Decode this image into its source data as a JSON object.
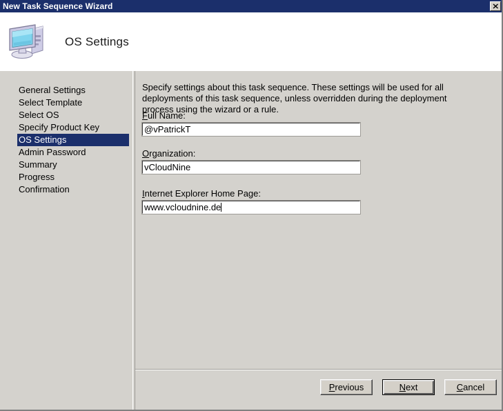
{
  "window": {
    "title": "New Task Sequence Wizard",
    "close_icon": "close-x-icon"
  },
  "header": {
    "title": "OS Settings",
    "icon": "computer-monitor-icon"
  },
  "navigation": {
    "items": [
      {
        "label": "General Settings",
        "selected": false
      },
      {
        "label": "Select Template",
        "selected": false
      },
      {
        "label": "Select OS",
        "selected": false
      },
      {
        "label": "Specify Product Key",
        "selected": false
      },
      {
        "label": "OS Settings",
        "selected": true
      },
      {
        "label": "Admin Password",
        "selected": false
      },
      {
        "label": "Summary",
        "selected": false
      },
      {
        "label": "Progress",
        "selected": false
      },
      {
        "label": "Confirmation",
        "selected": false
      }
    ]
  },
  "content": {
    "intro": "Specify settings about this task sequence.  These settings will be used for all deployments of this task sequence, unless overridden during the deployment process using the wizard or a rule.",
    "fields": {
      "full_name": {
        "label_prefix": "",
        "label_accel": "F",
        "label_suffix": "ull Name:",
        "value": "@vPatrickT",
        "placeholder": ""
      },
      "organization": {
        "label_prefix": "",
        "label_accel": "O",
        "label_suffix": "rganization:",
        "value": "vCloudNine",
        "placeholder": ""
      },
      "ie_home_page": {
        "label_prefix": "",
        "label_accel": "I",
        "label_suffix": "nternet Explorer Home Page:",
        "value": "www.vcloudnine.de",
        "placeholder": ""
      }
    }
  },
  "buttons": {
    "previous": {
      "accel": "P",
      "rest": "revious",
      "default": false
    },
    "next": {
      "accel": "N",
      "rest": "ext",
      "default": true
    },
    "cancel": {
      "accel": "C",
      "rest": "ancel",
      "default": false
    }
  },
  "colors": {
    "titlebar": "#1b2f6b",
    "dialog_face": "#d4d2cd",
    "selection": "#1b2f6b",
    "header_band": "#ffffff"
  }
}
